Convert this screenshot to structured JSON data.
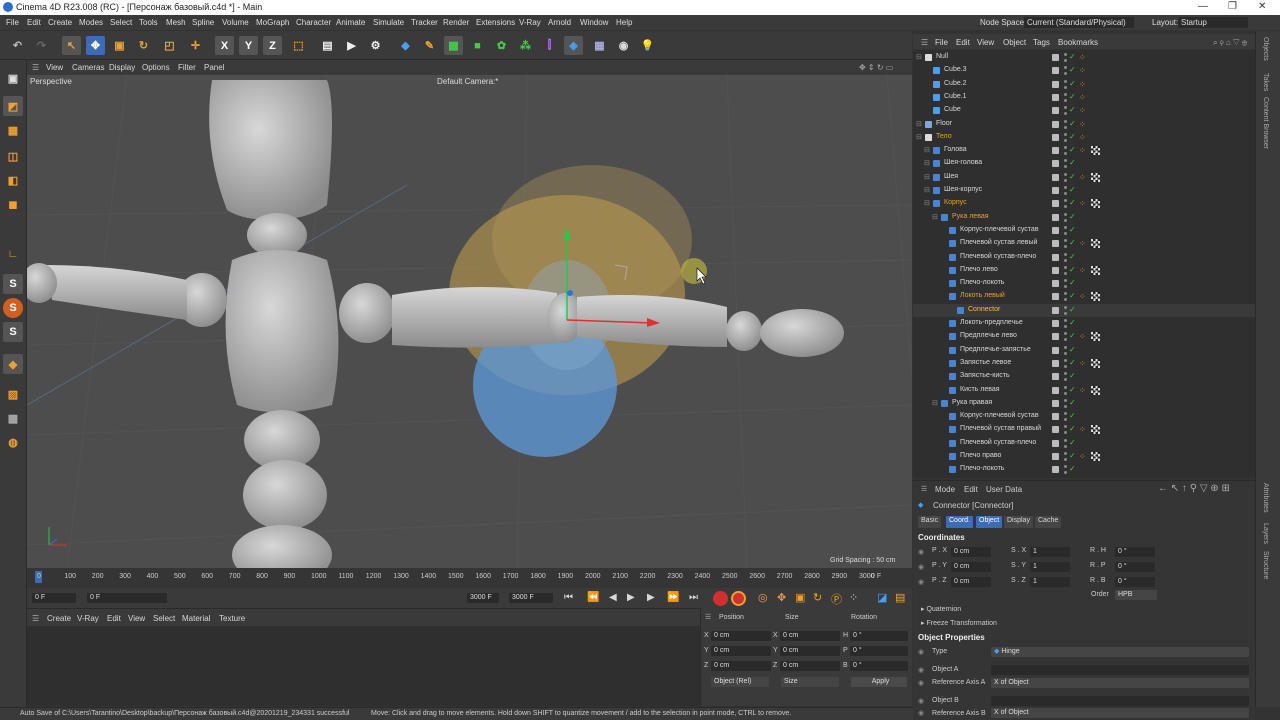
{
  "window": {
    "title": "Cinema 4D R23.008 (RC) - [Персонаж базовый.c4d *] - Main",
    "controls": [
      "—",
      "❐",
      "✕"
    ]
  },
  "menu": [
    "File",
    "Edit",
    "Create",
    "Modes",
    "Select",
    "Tools",
    "Mesh",
    "Spline",
    "Volume",
    "MoGraph",
    "Character",
    "Animate",
    "Simulate",
    "Tracker",
    "Render",
    "Extensions",
    "V-Ray",
    "Arnold",
    "Window",
    "Help"
  ],
  "nodespace": {
    "label": "Node Space:",
    "value": "Current (Standard/Physical)"
  },
  "layout": {
    "label": "Layout:",
    "value": "Startup"
  },
  "toolbar": {
    "axis_labels": [
      "X",
      "Y",
      "Z"
    ]
  },
  "viewport": {
    "menu": [
      "View",
      "Cameras",
      "Display",
      "Options",
      "Filter",
      "Panel"
    ],
    "view_name": "Perspective",
    "camera": "Default Camera:*",
    "grid_spacing": "Grid Spacing : 50 cm"
  },
  "timeline": {
    "ticks": [
      "0",
      "100",
      "200",
      "300",
      "400",
      "500",
      "600",
      "700",
      "800",
      "900",
      "1000",
      "1100",
      "1200",
      "1300",
      "1400",
      "1500",
      "1600",
      "1700",
      "1800",
      "1900",
      "2000",
      "2100",
      "2200",
      "2300",
      "2400",
      "2500",
      "2600",
      "2700",
      "2800",
      "2900",
      "3000"
    ],
    "current": "0 F"
  },
  "transport": {
    "start": "0 F",
    "current": "0 F",
    "end": "3000 F",
    "end2": "3000 F"
  },
  "material_menu": [
    "Create",
    "V-Ray",
    "Edit",
    "View",
    "Select",
    "Material",
    "Texture"
  ],
  "coords": {
    "headers": [
      "Position",
      "Size",
      "Rotation"
    ],
    "rows": [
      {
        "axis": "X",
        "pos": "0 cm",
        "size": "0 cm",
        "rot_axis": "H",
        "rot": "0 °"
      },
      {
        "axis": "Y",
        "pos": "0 cm",
        "size": "0 cm",
        "rot_axis": "P",
        "rot": "0 °"
      },
      {
        "axis": "Z",
        "pos": "0 cm",
        "size": "0 cm",
        "rot_axis": "B",
        "rot": "0 °"
      }
    ],
    "mode": "Object (Rel)",
    "size_mode": "Size",
    "apply": "Apply"
  },
  "status": {
    "left": "Auto Save of C:\\Users\\Tarantino\\Desktop\\backup\\Персонаж базовый.c4d@20201219_234331 successful",
    "right": "Move: Click and drag to move elements. Hold down SHIFT to quantize movement / add to the selection in point mode, CTRL to remove."
  },
  "objects": {
    "menu": [
      "File",
      "Edit",
      "View",
      "Object",
      "Tags",
      "Bookmarks"
    ],
    "rows": [
      {
        "name": "Null",
        "indent": 0,
        "color": "#d8d8d8",
        "tags": "filter"
      },
      {
        "name": "Cube.3",
        "indent": 1,
        "color": "#d8d8d8",
        "tags": "x"
      },
      {
        "name": "Cube.2",
        "indent": 1,
        "color": "#d8d8d8",
        "tags": "x"
      },
      {
        "name": "Cube.1",
        "indent": 1,
        "color": "#d8d8d8",
        "tags": "x"
      },
      {
        "name": "Cube",
        "indent": 1,
        "color": "#d8d8d8",
        "tags": "x"
      },
      {
        "name": "Floor",
        "indent": 0,
        "color": "#d8d8d8",
        "tags": "filter"
      },
      {
        "name": "Тело",
        "indent": 0,
        "color": "#e9a030",
        "tags": "filter"
      },
      {
        "name": "Голова",
        "indent": 1,
        "color": "#d8d8d8",
        "tags": "xc"
      },
      {
        "name": "Шея-голова",
        "indent": 1,
        "color": "#d8d8d8",
        "tags": ""
      },
      {
        "name": "Шея",
        "indent": 1,
        "color": "#d8d8d8",
        "tags": "xc"
      },
      {
        "name": "Шея-корпус",
        "indent": 1,
        "color": "#d8d8d8",
        "tags": ""
      },
      {
        "name": "Корпус",
        "indent": 1,
        "color": "#e9a030",
        "tags": "xc"
      },
      {
        "name": "Рука левая",
        "indent": 2,
        "color": "#e9a030",
        "tags": ""
      },
      {
        "name": "Корпус-плечевой сустав",
        "indent": 3,
        "color": "#d8d8d8",
        "tags": ""
      },
      {
        "name": "Плечевой сустав левый",
        "indent": 3,
        "color": "#d8d8d8",
        "tags": "xc"
      },
      {
        "name": "Плечевой сустав-плечо",
        "indent": 3,
        "color": "#d8d8d8",
        "tags": ""
      },
      {
        "name": "Плечо лево",
        "indent": 3,
        "color": "#d8d8d8",
        "tags": "xc"
      },
      {
        "name": "Плечо-локоть",
        "indent": 3,
        "color": "#d8d8d8",
        "tags": ""
      },
      {
        "name": "Локоть левый",
        "indent": 3,
        "color": "#e9a030",
        "tags": "xc"
      },
      {
        "name": "Connector",
        "indent": 4,
        "color": "#f0c040",
        "tags": ""
      },
      {
        "name": "Локоть-предплечье",
        "indent": 3,
        "color": "#d8d8d8",
        "tags": ""
      },
      {
        "name": "Предплечье лево",
        "indent": 3,
        "color": "#d8d8d8",
        "tags": "xc"
      },
      {
        "name": "Предплечье-запястье",
        "indent": 3,
        "color": "#d8d8d8",
        "tags": ""
      },
      {
        "name": "Запястье левое",
        "indent": 3,
        "color": "#d8d8d8",
        "tags": "xc"
      },
      {
        "name": "Запястье-кисть",
        "indent": 3,
        "color": "#d8d8d8",
        "tags": ""
      },
      {
        "name": "Кисть левая",
        "indent": 3,
        "color": "#d8d8d8",
        "tags": "xc"
      },
      {
        "name": "Рука правая",
        "indent": 2,
        "color": "#d8d8d8",
        "tags": ""
      },
      {
        "name": "Корпус-плечевой сустав",
        "indent": 3,
        "color": "#d8d8d8",
        "tags": ""
      },
      {
        "name": "Плечевой сустав правый",
        "indent": 3,
        "color": "#d8d8d8",
        "tags": "xc"
      },
      {
        "name": "Плечевой сустав-плечо",
        "indent": 3,
        "color": "#d8d8d8",
        "tags": ""
      },
      {
        "name": "Плечо право",
        "indent": 3,
        "color": "#d8d8d8",
        "tags": "xc"
      },
      {
        "name": "Плечо-локоть",
        "indent": 3,
        "color": "#d8d8d8",
        "tags": ""
      }
    ]
  },
  "attributes": {
    "menu": [
      "Mode",
      "Edit",
      "User Data"
    ],
    "object_title": "Connector [Connector]",
    "tabs": [
      "Basic",
      "Coord.",
      "Object",
      "Display",
      "Cache"
    ],
    "coordinates_title": "Coordinates",
    "coord_rows": [
      {
        "p": "P . X",
        "pv": "0 cm",
        "s": "S . X",
        "sv": "1",
        "r": "R . H",
        "rv": "0 °"
      },
      {
        "p": "P . Y",
        "pv": "0 cm",
        "s": "S . Y",
        "sv": "1",
        "r": "R . P",
        "rv": "0 °"
      },
      {
        "p": "P . Z",
        "pv": "0 cm",
        "s": "S . Z",
        "sv": "1",
        "r": "R . B",
        "rv": "0 °"
      }
    ],
    "order_label": "Order",
    "order_value": "HPB",
    "quaternion": "Quaternion",
    "freeze": "Freeze Transformation",
    "object_props": "Object Properties",
    "type_label": "Type",
    "type_value": "Hinge",
    "obj_a_label": "Object A",
    "ref_a_label": "Reference Axis A",
    "ref_a_value": "X of Object",
    "obj_b_label": "Object B",
    "ref_b_label": "Reference Axis B",
    "ref_b_value": "X of Object"
  },
  "right_strip": [
    "Objects",
    "Takes",
    "Content Browser",
    "Layers",
    "Attributes",
    "Layers",
    "Structure"
  ]
}
